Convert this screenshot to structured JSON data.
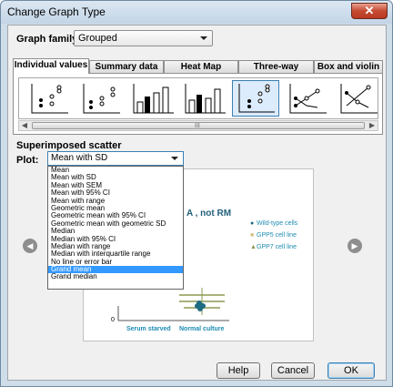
{
  "window": {
    "title": "Change Graph Type",
    "close_glyph": "✕"
  },
  "graph_family": {
    "label": "Graph family:",
    "value": "Grouped"
  },
  "tabs": [
    {
      "label": "Individual values",
      "active": true
    },
    {
      "label": "Summary data",
      "active": false
    },
    {
      "label": "Heat Map",
      "active": false
    },
    {
      "label": "Three-way",
      "active": false
    },
    {
      "label": "Box and violin",
      "active": false
    }
  ],
  "scroll": {
    "grip": "III"
  },
  "superimposed": {
    "section_label": "Superimposed scatter",
    "plot_label": "Plot:",
    "plot_value": "Mean with SD"
  },
  "plot_options": [
    "Mean",
    "Mean with SD",
    "Mean with SEM",
    "Mean with 95% CI",
    "Mean with range",
    "Geometric mean",
    "Geometric mean with 95% CI",
    "Geometric mean with geometric SD",
    "Median",
    "Median with 95% CI",
    "Median with range",
    "Median with interquartile range",
    "No line or error bar",
    "Grand mean",
    "Grand median"
  ],
  "selected_option": "Grand mean",
  "preview": {
    "title_fragment": "A , not RM",
    "zero_label": "0",
    "x_labels": [
      "Serum starved",
      "Normal culture"
    ],
    "legend": [
      "Wild-type cells",
      "GPP5 cell line",
      "GPP7 cell line"
    ],
    "legend_colors": [
      "#1f6b82",
      "#d6c089",
      "#8a9a52"
    ]
  },
  "buttons": {
    "help": "Help",
    "cancel": "Cancel",
    "ok": "OK"
  },
  "nav": {
    "prev": "◀",
    "next": "▶"
  }
}
